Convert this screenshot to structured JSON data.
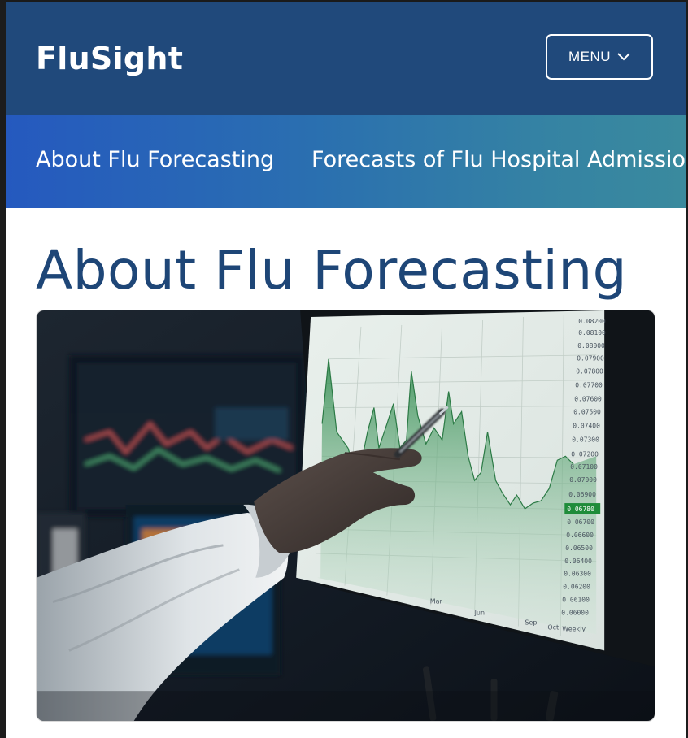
{
  "site": {
    "brand": "FluSight",
    "menu_label": "MENU"
  },
  "subnav": {
    "items": [
      {
        "label": "About Flu Forecasting"
      },
      {
        "label": "Forecasts of Flu Hospital Admissions"
      }
    ]
  },
  "main": {
    "title": "About Flu Forecasting"
  },
  "hero": {
    "subject": "hand-pointing-at-stock-chart-monitor",
    "chart_axis_values": [
      "0.08200",
      "0.08100",
      "0.08000",
      "0.07900",
      "0.07800",
      "0.07700",
      "0.07600",
      "0.07500",
      "0.07400",
      "0.07300",
      "0.07200",
      "0.07100",
      "0.07000",
      "0.06900",
      "0.06780",
      "0.06700",
      "0.06600",
      "0.06500",
      "0.06400",
      "0.06300",
      "0.06200",
      "0.06100",
      "0.06000"
    ],
    "chart_months": [
      "Mar",
      "Jun",
      "Sep",
      "Oct",
      "Weekly"
    ]
  },
  "colors": {
    "navbar": "#20497b",
    "subnav_start": "#2559bf",
    "subnav_end": "#3a8a9e",
    "title": "#1e4677",
    "chart_green": "#2e8a4e"
  }
}
